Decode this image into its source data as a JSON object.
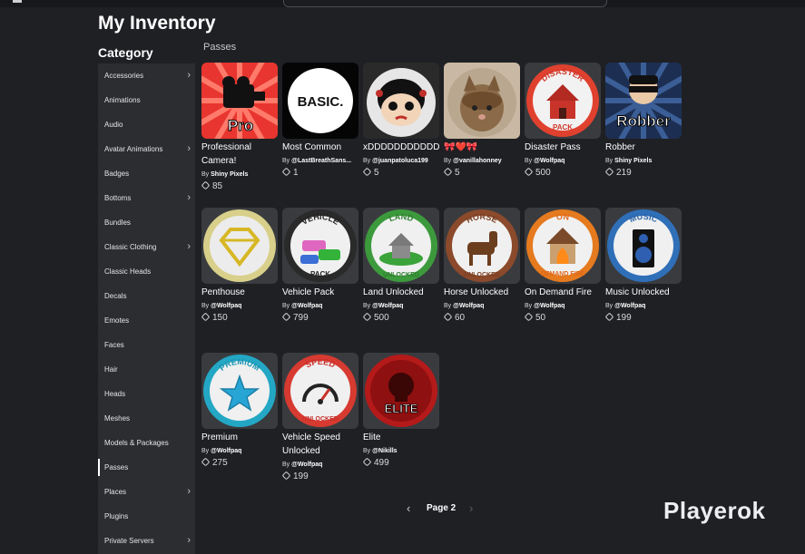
{
  "header": {
    "title": "My Inventory",
    "category_title": "Category",
    "section_label": "Passes"
  },
  "sidebar": {
    "items": [
      {
        "label": "Accessories",
        "chevron": true
      },
      {
        "label": "Animations",
        "chevron": false
      },
      {
        "label": "Audio",
        "chevron": false
      },
      {
        "label": "Avatar Animations",
        "chevron": true
      },
      {
        "label": "Badges",
        "chevron": false
      },
      {
        "label": "Bottoms",
        "chevron": true
      },
      {
        "label": "Bundles",
        "chevron": false
      },
      {
        "label": "Classic Clothing",
        "chevron": true
      },
      {
        "label": "Classic Heads",
        "chevron": false
      },
      {
        "label": "Decals",
        "chevron": false
      },
      {
        "label": "Emotes",
        "chevron": false
      },
      {
        "label": "Faces",
        "chevron": false
      },
      {
        "label": "Hair",
        "chevron": false
      },
      {
        "label": "Heads",
        "chevron": false
      },
      {
        "label": "Meshes",
        "chevron": false
      },
      {
        "label": "Models & Packages",
        "chevron": false
      },
      {
        "label": "Passes",
        "chevron": false,
        "active": true
      },
      {
        "label": "Places",
        "chevron": true
      },
      {
        "label": "Plugins",
        "chevron": false
      },
      {
        "label": "Private Servers",
        "chevron": true
      }
    ]
  },
  "items": [
    {
      "name": "Professional Camera!",
      "by": "By",
      "creator": "Shiny Pixels",
      "price": "85",
      "icon": "pro-camera-icon",
      "thumb_text": "Pro"
    },
    {
      "name": "Most Common",
      "by": "By",
      "creator": "@LastBreathSans...",
      "price": "1",
      "icon": "basic-text-icon",
      "thumb_text": "BASIC."
    },
    {
      "name": "xDDDDDDDDDDD",
      "by": "By",
      "creator": "@juanpatoluca199",
      "price": "5",
      "icon": "cartoon-girl-icon",
      "thumb_text": ""
    },
    {
      "name": "🎀❤️🎀",
      "by": "By",
      "creator": "@vanillahonney",
      "price": "5",
      "icon": "cat-photo-icon",
      "thumb_text": ""
    },
    {
      "name": "Disaster Pass",
      "by": "By",
      "creator": "@Wolfpaq",
      "price": "500",
      "icon": "disaster-house-icon",
      "thumb_text": "DISASTER"
    },
    {
      "name": "Robber",
      "by": "By",
      "creator": "Shiny Pixels",
      "price": "219",
      "icon": "robber-icon",
      "thumb_text": "Robber"
    },
    {
      "name": "Penthouse",
      "by": "By",
      "creator": "@Wolfpaq",
      "price": "150",
      "icon": "diamond-icon",
      "thumb_text": ""
    },
    {
      "name": "Vehicle Pack",
      "by": "By",
      "creator": "@Wolfpaq",
      "price": "799",
      "icon": "vehicle-pack-icon",
      "thumb_text": "VEHICLE"
    },
    {
      "name": "Land Unlocked",
      "by": "By",
      "creator": "@Wolfpaq",
      "price": "500",
      "icon": "land-icon",
      "thumb_text": "LAND"
    },
    {
      "name": "Horse Unlocked",
      "by": "By",
      "creator": "@Wolfpaq",
      "price": "60",
      "icon": "horse-icon",
      "thumb_text": "HORSE"
    },
    {
      "name": "On Demand Fire",
      "by": "By",
      "creator": "@Wolfpaq",
      "price": "50",
      "icon": "fire-house-icon",
      "thumb_text": "ON"
    },
    {
      "name": "Music Unlocked",
      "by": "By",
      "creator": "@Wolfpaq",
      "price": "199",
      "icon": "speaker-icon",
      "thumb_text": "MUSIC"
    },
    {
      "name": "Premium",
      "by": "By",
      "creator": "@Wolfpaq",
      "price": "275",
      "icon": "star-icon",
      "thumb_text": "PREMIUM"
    },
    {
      "name": "Vehicle Speed Unlocked",
      "by": "By",
      "creator": "@Wolfpaq",
      "price": "199",
      "icon": "speedometer-icon",
      "thumb_text": "SPEED"
    },
    {
      "name": "Elite",
      "by": "By",
      "creator": "@Nikills",
      "price": "499",
      "icon": "skull-icon",
      "thumb_text": "ELITE"
    }
  ],
  "pagination": {
    "label": "Page 2",
    "prev_icon": "chevron-left-icon",
    "next_icon": "chevron-right-icon"
  },
  "watermark": "Playerok",
  "colors": {
    "background": "#1f2024",
    "sidebar": "#2b2d31",
    "card": "#393b3f",
    "text": "#ffffff"
  }
}
